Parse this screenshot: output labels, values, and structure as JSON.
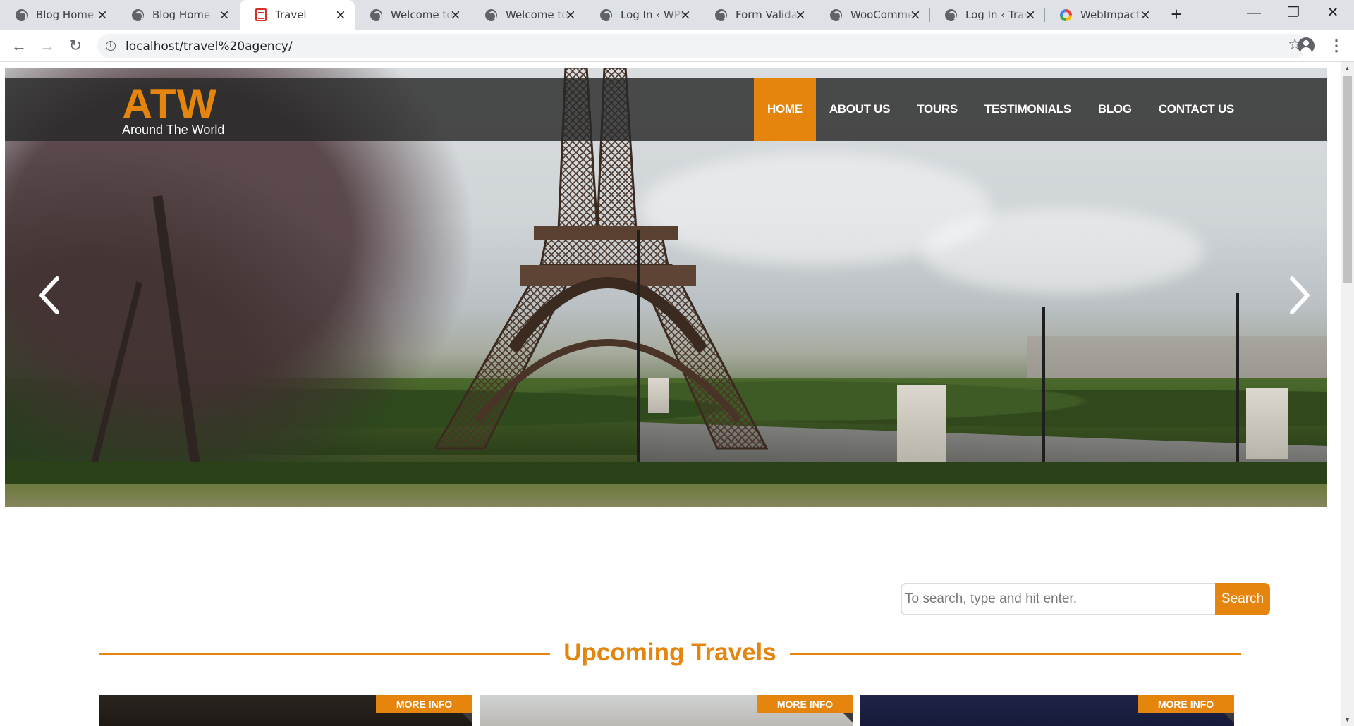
{
  "browser": {
    "tabs": [
      {
        "title": "Blog Home",
        "icon": "globe-icon",
        "active": false
      },
      {
        "title": "Blog Home",
        "icon": "globe-icon",
        "active": false
      },
      {
        "title": "Travel",
        "icon": "page-icon",
        "active": true
      },
      {
        "title": "Welcome to",
        "icon": "globe-icon",
        "active": false
      },
      {
        "title": "Welcome to",
        "icon": "globe-icon",
        "active": false
      },
      {
        "title": "Log In ‹ WPD",
        "icon": "globe-icon",
        "active": false
      },
      {
        "title": "Form Validati",
        "icon": "globe-icon",
        "active": false
      },
      {
        "title": "WooComme",
        "icon": "globe-icon",
        "active": false
      },
      {
        "title": "Log In ‹ Trav",
        "icon": "globe-icon",
        "active": false
      },
      {
        "title": "WebImpact",
        "icon": "webimpact-icon",
        "active": false
      }
    ],
    "url": "localhost/travel%20agency/"
  },
  "site": {
    "logo": {
      "brand": "ATW",
      "tagline": "Around The World"
    },
    "menu": [
      {
        "label": "HOME",
        "active": true
      },
      {
        "label": "ABOUT US",
        "active": false
      },
      {
        "label": "TOURS",
        "active": false
      },
      {
        "label": "TESTIMONIALS",
        "active": false
      },
      {
        "label": "BLOG",
        "active": false
      },
      {
        "label": "CONTACT US",
        "active": false
      }
    ],
    "search": {
      "placeholder": "To search, type and hit enter.",
      "button": "Search"
    },
    "section_title": "Upcoming Travels",
    "cards": [
      {
        "more_label": "MORE INFO"
      },
      {
        "more_label": "MORE INFO"
      },
      {
        "more_label": "MORE INFO"
      }
    ]
  },
  "colors": {
    "accent": "#e6850e",
    "nav_bg": "#282828"
  }
}
